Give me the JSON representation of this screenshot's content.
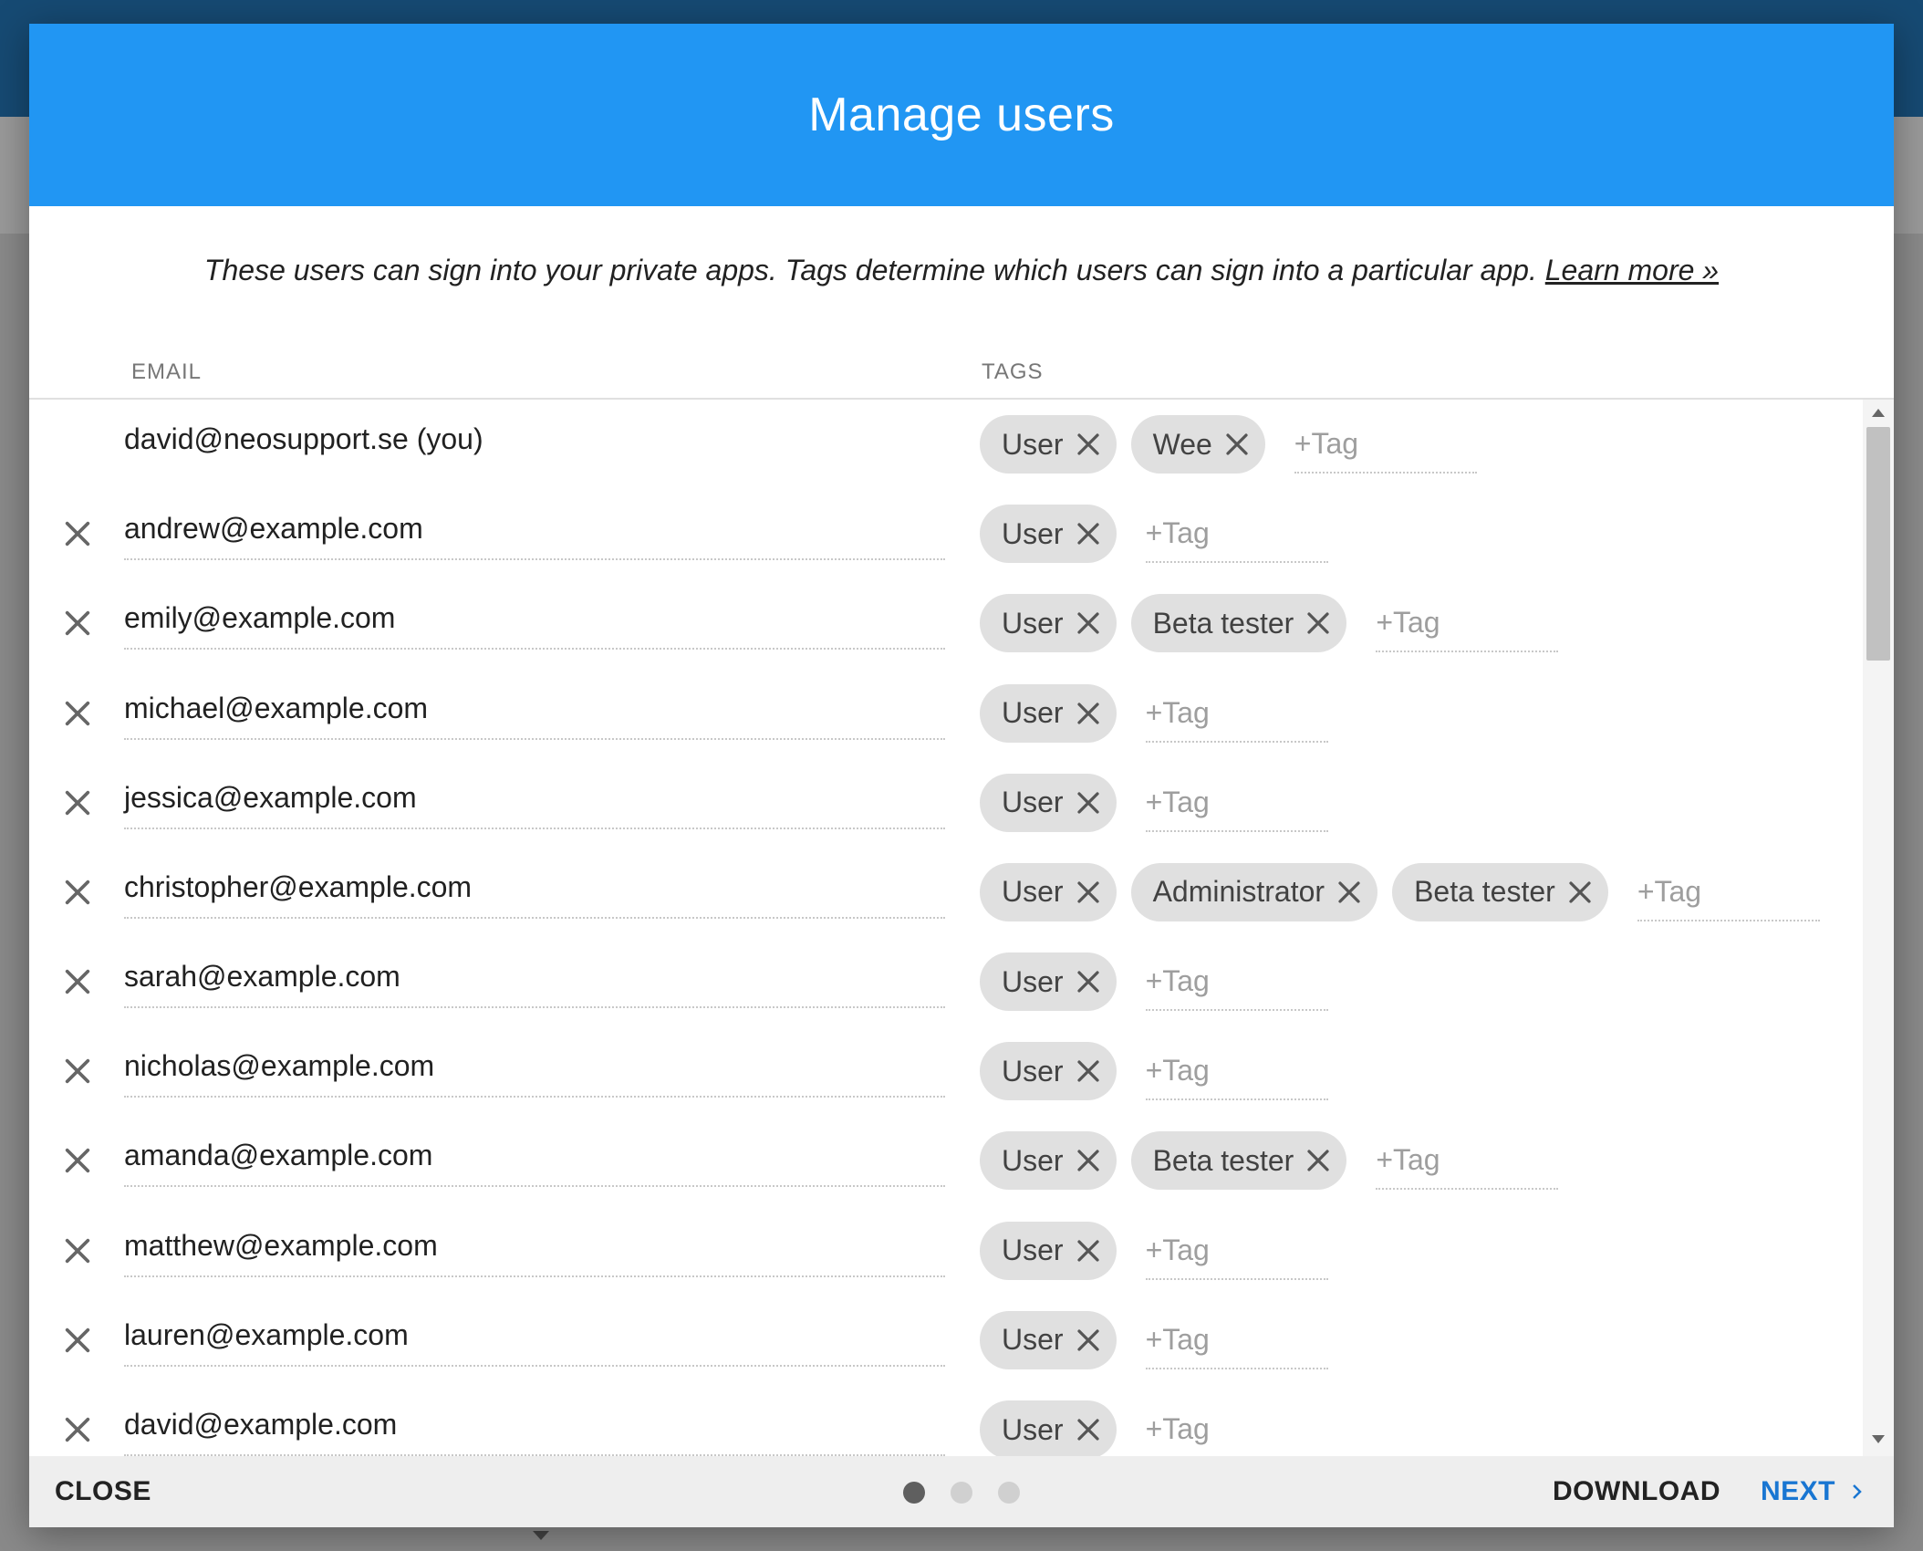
{
  "dialog": {
    "title": "Manage users",
    "intro_text": "These users can sign into your private apps. Tags determine which users can sign into a particular app.",
    "learn_more_label": "Learn more »"
  },
  "columns": {
    "email": "EMAIL",
    "tags": "TAGS"
  },
  "add_tag_placeholder": "+Tag",
  "users": [
    {
      "email": "david@neosupport.se (you)",
      "removable": false,
      "tags": [
        "User",
        "Wee"
      ]
    },
    {
      "email": "andrew@example.com",
      "removable": true,
      "tags": [
        "User"
      ]
    },
    {
      "email": "emily@example.com",
      "removable": true,
      "tags": [
        "User",
        "Beta tester"
      ]
    },
    {
      "email": "michael@example.com",
      "removable": true,
      "tags": [
        "User"
      ]
    },
    {
      "email": "jessica@example.com",
      "removable": true,
      "tags": [
        "User"
      ]
    },
    {
      "email": "christopher@example.com",
      "removable": true,
      "tags": [
        "User",
        "Administrator",
        "Beta tester"
      ]
    },
    {
      "email": "sarah@example.com",
      "removable": true,
      "tags": [
        "User"
      ]
    },
    {
      "email": "nicholas@example.com",
      "removable": true,
      "tags": [
        "User"
      ]
    },
    {
      "email": "amanda@example.com",
      "removable": true,
      "tags": [
        "User",
        "Beta tester"
      ]
    },
    {
      "email": "matthew@example.com",
      "removable": true,
      "tags": [
        "User"
      ]
    },
    {
      "email": "lauren@example.com",
      "removable": true,
      "tags": [
        "User"
      ]
    },
    {
      "email": "david@example.com",
      "removable": true,
      "tags": [
        "User"
      ]
    }
  ],
  "footer": {
    "close_label": "CLOSE",
    "download_label": "DOWNLOAD",
    "next_label": "NEXT",
    "steps_total": 3,
    "current_step": 1
  },
  "icons": {
    "remove": "close-icon",
    "chip_remove": "close-icon",
    "next": "chevron-right-icon"
  },
  "colors": {
    "header": "#2196f3",
    "accent_link": "#1976d2",
    "chip": "#e0e0e0"
  }
}
